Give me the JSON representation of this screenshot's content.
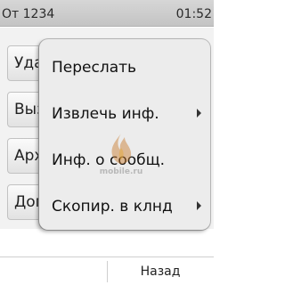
{
  "status_bar": {
    "left": "От 1234",
    "right": "01:52"
  },
  "background_list": {
    "items": [
      {
        "label": "Удалить"
      },
      {
        "label": "Вызвать"
      },
      {
        "label": "Архив"
      },
      {
        "label": "Доп"
      }
    ]
  },
  "popup_menu": {
    "items": [
      {
        "label": "Переслать",
        "has_submenu": false
      },
      {
        "label": "Извлечь инф.",
        "has_submenu": true
      },
      {
        "label": "Инф. о сообщ.",
        "has_submenu": false
      },
      {
        "label": "Скопир. в клнд",
        "has_submenu": true
      }
    ]
  },
  "watermark": {
    "text": "mobile.ru"
  },
  "softkeys": {
    "right_label": "Назад"
  }
}
